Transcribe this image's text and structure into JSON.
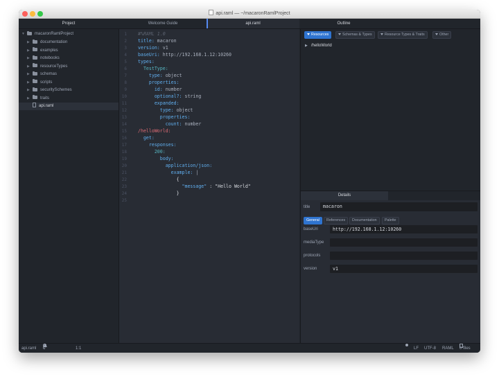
{
  "window": {
    "title": "api.raml — ~/macaronRamlProject"
  },
  "tabs": {
    "project": "Project",
    "welcome": "Welcome Guide",
    "api": "api.raml",
    "outline": "Outline"
  },
  "tree": {
    "root": "macaronRamlProject",
    "folders": [
      "documentation",
      "examples",
      "notebooks",
      "resourceTypes",
      "schemas",
      "scripts",
      "securitySchemes",
      "traits"
    ],
    "file": "api.raml"
  },
  "editor": {
    "line_numbers": [
      "1",
      "2",
      "3",
      "4",
      "5",
      "6",
      "7",
      "8",
      "9",
      "10",
      "11",
      "12",
      "13",
      "14",
      "15",
      "16",
      "17",
      "18",
      "19",
      "20",
      "21",
      "22",
      "23",
      "24",
      "25"
    ],
    "lines": {
      "l1": "#%RAML 1.0",
      "l2_k": "title:",
      "l2_v": " macaron",
      "l3_k": "version:",
      "l3_v": " v1",
      "l4_k": "baseUri:",
      "l4_v": " http://192.168.1.12:10260",
      "l5_k": "types:",
      "l6_k": "  TestType:",
      "l7_k": "    type:",
      "l7_v": " object",
      "l8_k": "    properties:",
      "l9_k": "      id:",
      "l9_v": " number",
      "l10_k": "      optional?:",
      "l10_v": " string",
      "l11_k": "      expanded:",
      "l12_k": "        type:",
      "l12_v": " object",
      "l13_k": "        properties:",
      "l14_k": "          count:",
      "l14_v": " number",
      "l15_k": "/helloWorld:",
      "l16_k": "  get:",
      "l17_k": "    responses:",
      "l18_k": "      200:",
      "l19_k": "        body:",
      "l20_k": "          application/json:",
      "l21_k": "            example:",
      "l21_v": " |",
      "l22": "              {",
      "l23_k": "                \"message\"",
      "l23_v": " : \"Hello World\"",
      "l24": "              }"
    }
  },
  "outline": {
    "filters": [
      "Resources",
      "Schemas & Types",
      "Resource Types & Traits",
      "Other"
    ],
    "resource": "/helloWorld"
  },
  "details": {
    "header": "Details",
    "title_label": "title",
    "title_value": "macaron",
    "tabs": [
      "General",
      "References",
      "Documentation",
      "Palette"
    ],
    "baseUri_label": "baseUri",
    "baseUri_value": "http://192.168.1.12:10260",
    "mediaType_label": "mediaType",
    "mediaType_value": "",
    "protocols_label": "protocols",
    "protocols_value": "",
    "version_label": "version",
    "version_value": "v1"
  },
  "statusbar": {
    "file": "api.raml",
    "errors": "0",
    "warnings": "0",
    "infos": "0",
    "cursor": "1:1",
    "line_ending": "LF",
    "encoding": "UTF-8",
    "grammar": "RAML",
    "files": "0 files"
  },
  "colors": {
    "accent": "#2f74d0",
    "route": "#e06c75",
    "key": "#61afef"
  }
}
